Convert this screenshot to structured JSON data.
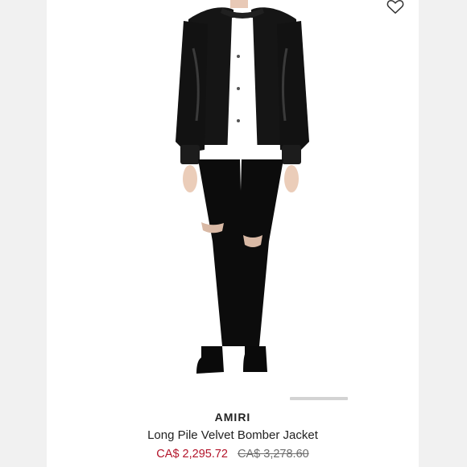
{
  "product": {
    "brand": "AMIRI",
    "name": "Long Pile Velvet Bomber Jacket",
    "sale_price": "CA$ 2,295.72",
    "original_price": "CA$ 3,278.60"
  },
  "icons": {
    "wishlist": "heart-outline-icon"
  },
  "colors": {
    "sale_price": "#b3142a",
    "original_price": "#6e6e6e",
    "background": "#f1f1f1"
  }
}
